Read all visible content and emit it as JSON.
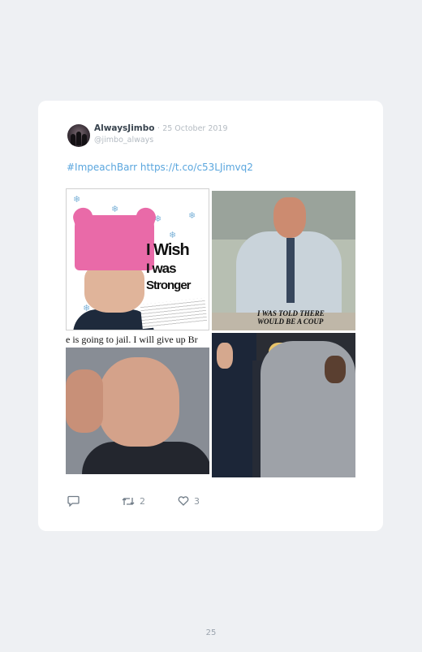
{
  "tweet": {
    "author_name": "AlwaysJimbo",
    "separator": "·",
    "date": "25 October 2019",
    "handle": "@jimbo_always",
    "hashtag": "#ImpeachBarr",
    "link": "https://t.co/c53LJimvq2"
  },
  "images": [
    {
      "name": "comey-pink-hat",
      "text_lines": [
        "I Wish",
        "I was",
        "Stronger"
      ]
    },
    {
      "name": "brennan-office",
      "caption_lines": [
        "I WAS TOLD THERE",
        "WOULD BE A COUP"
      ]
    },
    {
      "name": "clapper-hand-on-face",
      "caption": "e is going to jail. I will give up Br"
    },
    {
      "name": "barr-trump-obama-hoodie"
    }
  ],
  "actions": {
    "reply_icon": "reply-icon",
    "retweet_icon": "retweet-icon",
    "retweet_count": "2",
    "like_icon": "heart-icon",
    "like_count": "3"
  },
  "page": {
    "number": "25"
  },
  "colors": {
    "background": "#eef0f3",
    "card": "#ffffff",
    "link": "#5aa6de",
    "muted": "#b4bbc2"
  }
}
